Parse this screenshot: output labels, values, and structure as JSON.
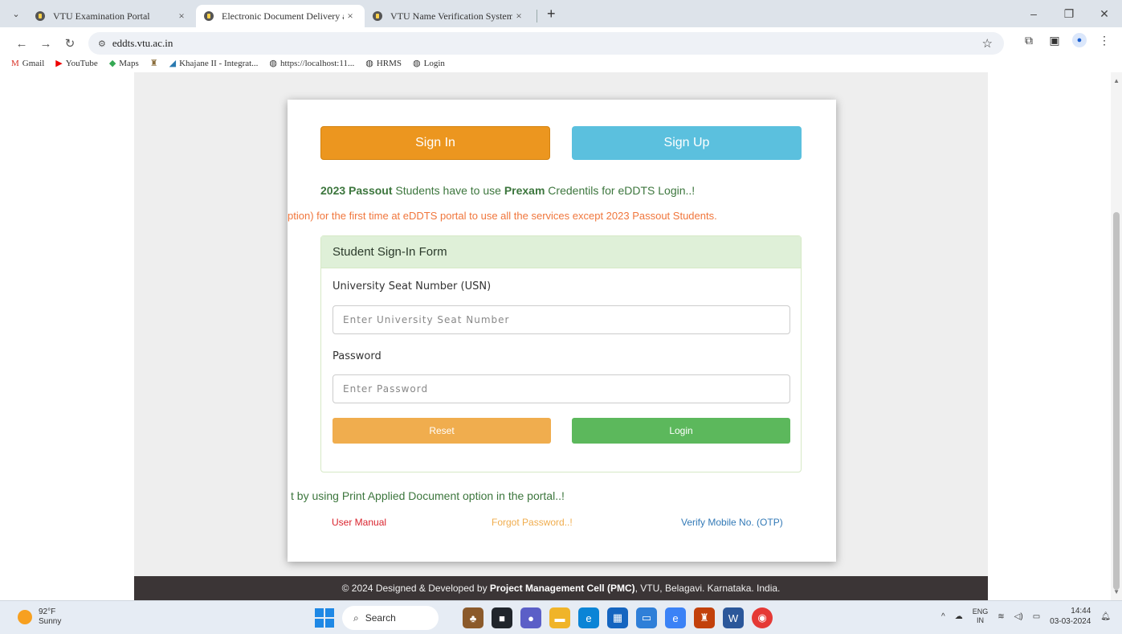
{
  "browser": {
    "tabs": [
      {
        "label": "VTU Examination Portal",
        "active": false
      },
      {
        "label": "Electronic Document Delivery a",
        "active": true
      },
      {
        "label": "VTU Name Verification System",
        "active": false
      }
    ],
    "url": "eddts.vtu.ac.in",
    "bookmarks": [
      "Gmail",
      "YouTube",
      "Maps",
      "",
      "Khajane II - Integrat...",
      "https://localhost:11...",
      "HRMS",
      "Login"
    ]
  },
  "page": {
    "signin_label": "Sign In",
    "signup_label": "Sign Up",
    "notice1": {
      "bold1": "2023 Passout",
      "mid": " Students have to use ",
      "bold2": "Prexam",
      "end": " Credentils for eDDTS Login..!"
    },
    "notice2": "ption) for the first time at eDDTS portal to use all the services except 2023 Passout Students.",
    "form": {
      "title": "Student Sign-In Form",
      "usn_label": "University Seat Number (USN)",
      "usn_placeholder": "Enter University Seat Number",
      "password_label": "Password",
      "password_placeholder": "Enter Password",
      "reset_label": "Reset",
      "login_label": "Login"
    },
    "notice3": "t by using Print Applied Document option in the portal..!",
    "links": {
      "user_manual": "User Manual",
      "forgot": "Forgot Password..!",
      "verify": "Verify Mobile No. (OTP)"
    },
    "footer": {
      "prefix": "© 2024 Designed & Developed by ",
      "bold": "Project Management Cell (PMC)",
      "suffix": ", VTU, Belagavi. Karnataka. India."
    }
  },
  "taskbar": {
    "weather_temp": "92°F",
    "weather_desc": "Sunny",
    "search_label": "Search",
    "lang_line1": "ENG",
    "lang_line2": "IN",
    "time": "14:44",
    "date": "03-03-2024"
  },
  "colors": {
    "signin": "#ec961f",
    "signup": "#5bc0de",
    "reset": "#f0ad4e",
    "login": "#5cb85c",
    "panel_head": "#dff0d8",
    "footer": "#3b3536"
  }
}
